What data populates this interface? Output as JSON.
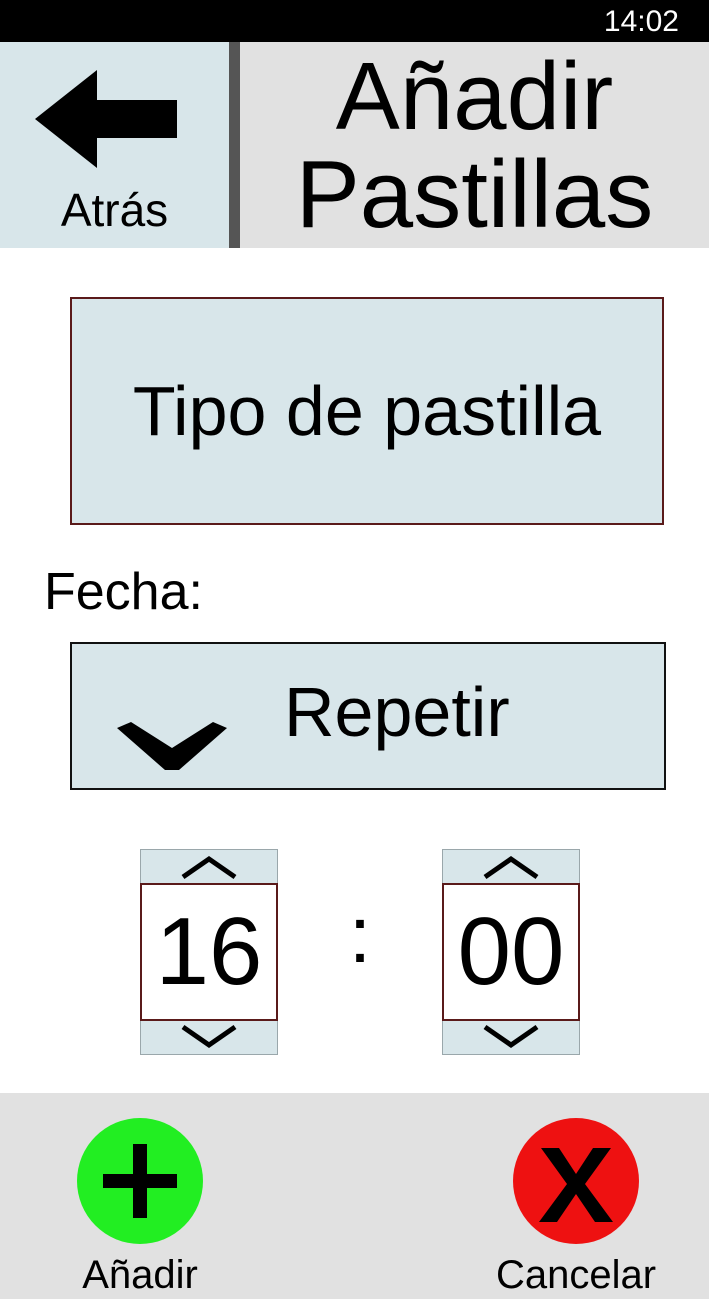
{
  "status_bar": {
    "time": "14:02"
  },
  "header": {
    "back_label": "Atrás",
    "back_icon": "arrow-left-icon",
    "title_line1": "Añadir",
    "title_line2": "Pastillas"
  },
  "form": {
    "pill_type_label": "Tipo de pastilla",
    "date_label": "Fecha:",
    "repeat_label": "Repetir",
    "repeat_icon": "chevron-down-icon"
  },
  "time": {
    "hour": "16",
    "minute": "00",
    "separator": ":"
  },
  "actions": {
    "add_label": "Añadir",
    "add_icon": "plus-icon",
    "cancel_label": "Cancelar",
    "cancel_icon": "x-icon"
  },
  "colors": {
    "panel_blue": "#d8e6ea",
    "header_gray": "#e1e1e1",
    "add_green": "#22ee22",
    "cancel_red": "#ee1111",
    "border_maroon": "#5a1a1a"
  }
}
